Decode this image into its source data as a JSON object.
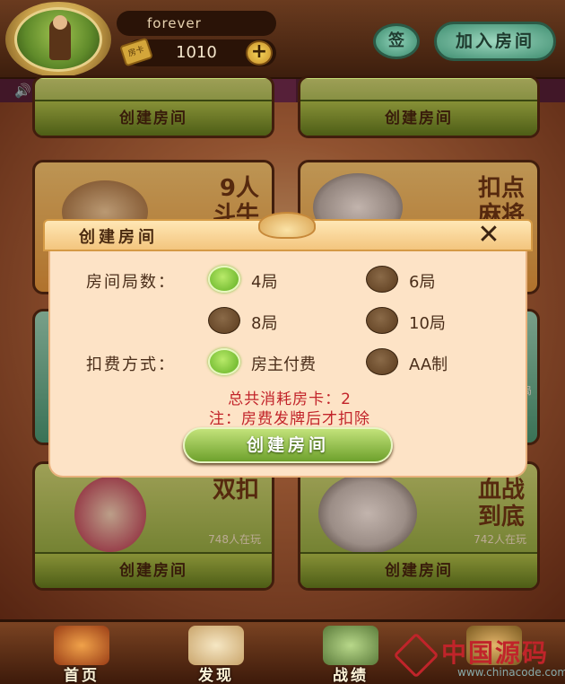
{
  "header": {
    "username": "forever",
    "card_icon_text": "房卡",
    "room_cards": "1010",
    "plus_label": "+",
    "sign_label": "签",
    "join_label": "加入房间"
  },
  "announcement": {
    "icon": "speaker-icon"
  },
  "games": [
    {
      "title_line1": "",
      "title_line2": "",
      "players": "",
      "button": "创建房间",
      "color": "green"
    },
    {
      "title_line1": "",
      "title_line2": "",
      "players": "",
      "button": "创建房间",
      "color": "green"
    },
    {
      "title_line1": "9人",
      "title_line2": "斗牛",
      "players": "",
      "button": "创建房间",
      "color": "orange"
    },
    {
      "title_line1": "扣点",
      "title_line2": "麻将",
      "players": "",
      "button": "创建房间",
      "color": "orange"
    },
    {
      "title_line1": "双扣",
      "title_line2": "",
      "players": "748人在玩",
      "button": "创建房间",
      "color": "green"
    },
    {
      "title_line1": "血战",
      "title_line2": "到底",
      "players": "742人在玩",
      "button": "创建房间",
      "color": "green"
    }
  ],
  "side_card_partial": "局",
  "bottom_nav": [
    {
      "label": "首页",
      "icon": "home-icon"
    },
    {
      "label": "发现",
      "icon": "discover-icon"
    },
    {
      "label": "战绩",
      "icon": "record-icon"
    },
    {
      "label": "",
      "icon": "helmet-icon"
    }
  ],
  "watermark": {
    "text": "中国源码",
    "url": "www.chinacode.com"
  },
  "modal": {
    "title": "创建房间",
    "close_label": "✕",
    "rounds_label": "房间局数：",
    "round_options": [
      {
        "label": "4局",
        "selected": true
      },
      {
        "label": "6局",
        "selected": false
      },
      {
        "label": "8局",
        "selected": false
      },
      {
        "label": "10局",
        "selected": false
      }
    ],
    "payment_label": "扣费方式：",
    "payment_options": [
      {
        "label": "房主付费",
        "selected": true
      },
      {
        "label": "AA制",
        "selected": false
      }
    ],
    "cost_text": "总共消耗房卡：2",
    "note_text": "注：房费发牌后才扣除",
    "create_label": "创建房间"
  },
  "colors": {
    "selected_radio": "#7fc33a",
    "unselected_radio": "#6a4a2a",
    "cost_text": "#c2242a",
    "modal_bg": "#fde3c6"
  }
}
